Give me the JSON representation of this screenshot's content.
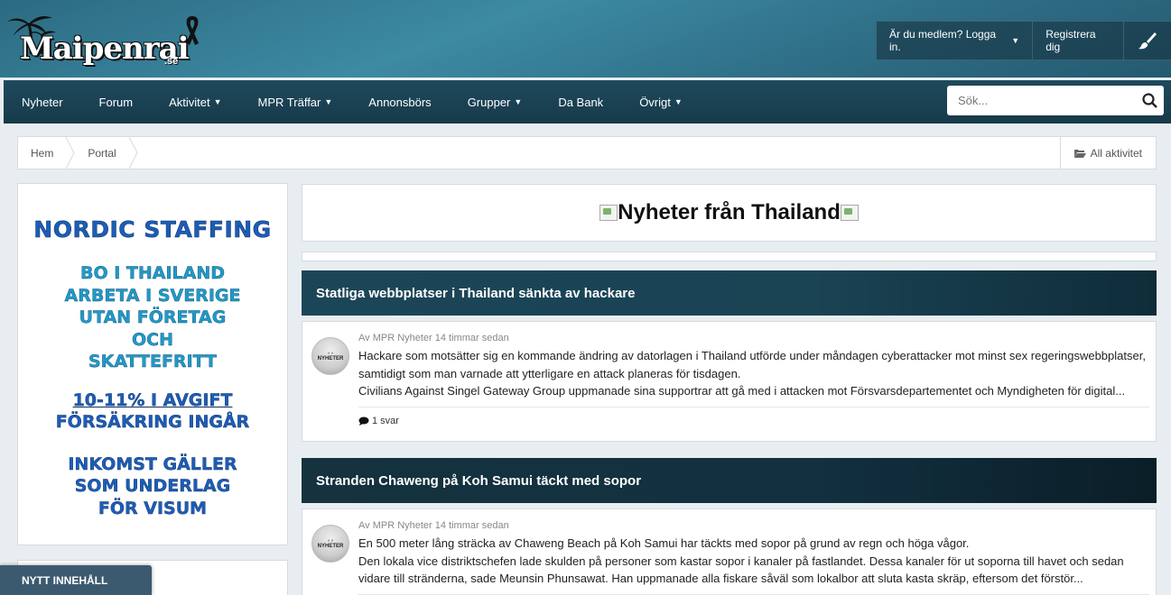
{
  "header": {
    "logo_text": "Maipenrai",
    "logo_suffix": ".se",
    "login_label": "Är du medlem? Logga in.",
    "register_label": "Registrera dig",
    "theme_icon": "paintbrush-icon"
  },
  "nav": {
    "items": [
      {
        "label": "Nyheter",
        "dropdown": false
      },
      {
        "label": "Forum",
        "dropdown": false
      },
      {
        "label": "Aktivitet",
        "dropdown": true
      },
      {
        "label": "MPR Träffar",
        "dropdown": true
      },
      {
        "label": "Annonsbörs",
        "dropdown": false
      },
      {
        "label": "Grupper",
        "dropdown": true
      },
      {
        "label": "Da Bank",
        "dropdown": false
      },
      {
        "label": "Övrigt",
        "dropdown": true
      }
    ],
    "search_placeholder": "Sök..."
  },
  "breadcrumb": {
    "items": [
      "Hem",
      "Portal"
    ],
    "all_activity": "All aktivitet"
  },
  "sidebar": {
    "ad": {
      "title": "NORDIC STAFFING",
      "block1": [
        "BO I THAILAND",
        "ARBETA I SVERIGE",
        "UTAN FÖRETAG",
        "OCH",
        "SKATTEFRITT"
      ],
      "block2": [
        "10-11% I AVGIFT",
        "FÖRSÄKRING INGÅR"
      ],
      "block3": [
        "INKOMST GÄLLER",
        "SOM UNDERLAG",
        "FÖR VISUM"
      ]
    },
    "new_content_label": "NYTT INNEHÅLL"
  },
  "main": {
    "title": "Nyheter från Thailand",
    "articles": [
      {
        "title": "Statliga webbplatser i Thailand sänkta av hackare",
        "avatar_label": "NYHETER",
        "meta": "Av MPR Nyheter 14 timmar sedan",
        "excerpt": [
          "Hackare som motsätter sig en kommande ändring av datorlagen i Thailand utförde under måndagen cyberattacker mot minst sex regeringswebbplatser,",
          "samtidigt som man varnade att ytterligare en attack planeras för tisdagen.",
          "Civilians Against Singel Gateway Group uppmanade sina supportrar att gå med i attacken mot Försvarsdepartementet och Myndigheten för digital..."
        ],
        "replies": "1 svar"
      },
      {
        "title": "Stranden Chaweng på Koh Samui täckt med sopor",
        "avatar_label": "NYHETER",
        "meta": "Av MPR Nyheter 14 timmar sedan",
        "excerpt": [
          "En 500 meter lång sträcka av Chaweng Beach på Koh Samui har täckts med sopor på grund av regn och höga vågor.",
          "Den lokala vice distriktschefen lade skulden på personer som kastar sopor i kanaler på fastlandet. Dessa kanaler för ut soporna till havet och sedan",
          "vidare till stränderna, sade Meunsin Phunsawat. Han uppmanade alla fiskare såväl som lokalbor att sluta kasta skräp, eftersom det förstör..."
        ],
        "replies": ""
      }
    ]
  }
}
